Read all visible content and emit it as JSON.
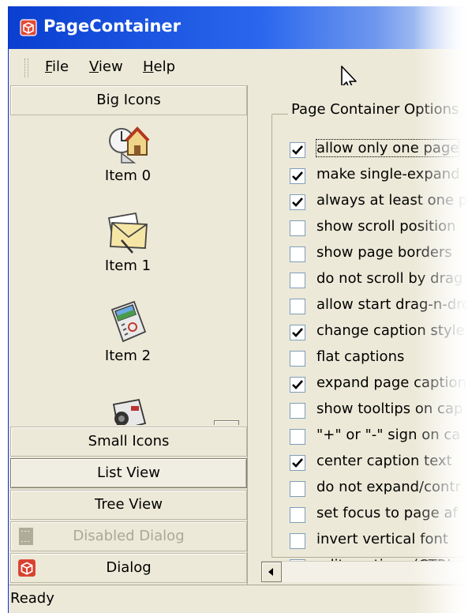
{
  "window": {
    "title": "PageContainer"
  },
  "menu": {
    "items": [
      {
        "label": "File",
        "accel": "F",
        "rest": "ile"
      },
      {
        "label": "View",
        "accel": "V",
        "rest": "iew"
      },
      {
        "label": "Help",
        "accel": "H",
        "rest": "elp"
      }
    ]
  },
  "pager": {
    "pages": [
      {
        "label": "Big Icons"
      },
      {
        "label": "Small Icons"
      },
      {
        "label": "List View"
      },
      {
        "label": "Tree View"
      },
      {
        "label": "Disabled Dialog"
      },
      {
        "label": "Dialog"
      }
    ],
    "big_items": [
      {
        "label": "Item 0",
        "icon": "house-clock-icon"
      },
      {
        "label": "Item 1",
        "icon": "mail-envelope-icon"
      },
      {
        "label": "Item 2",
        "icon": "calculator-icon"
      },
      {
        "label": "",
        "icon": "camera-icon"
      }
    ]
  },
  "options": {
    "group_title": "Page Container Options",
    "items": [
      {
        "label": "allow only one page",
        "checked": true
      },
      {
        "label": "make single-expand",
        "checked": true
      },
      {
        "label": "always at least one p",
        "checked": true
      },
      {
        "label": "show scroll position",
        "checked": false
      },
      {
        "label": "show page borders",
        "checked": false
      },
      {
        "label": "do not scroll by drag",
        "checked": false
      },
      {
        "label": "allow start drag-n-dro",
        "checked": false
      },
      {
        "label": "change caption style",
        "checked": true
      },
      {
        "label": "flat captions",
        "checked": false
      },
      {
        "label": "expand page caption",
        "checked": true
      },
      {
        "label": "show tooltips on cap",
        "checked": false
      },
      {
        "label": "\"+\" or \"-\" sign on ca",
        "checked": false
      },
      {
        "label": "center caption text",
        "checked": true
      },
      {
        "label": "do not expand/contr",
        "checked": false
      },
      {
        "label": "set focus to page af",
        "checked": false
      },
      {
        "label": "invert vertical font",
        "checked": false
      },
      {
        "label": "edit captions (CTRL",
        "checked": true
      }
    ]
  },
  "status": {
    "text": "Ready"
  }
}
